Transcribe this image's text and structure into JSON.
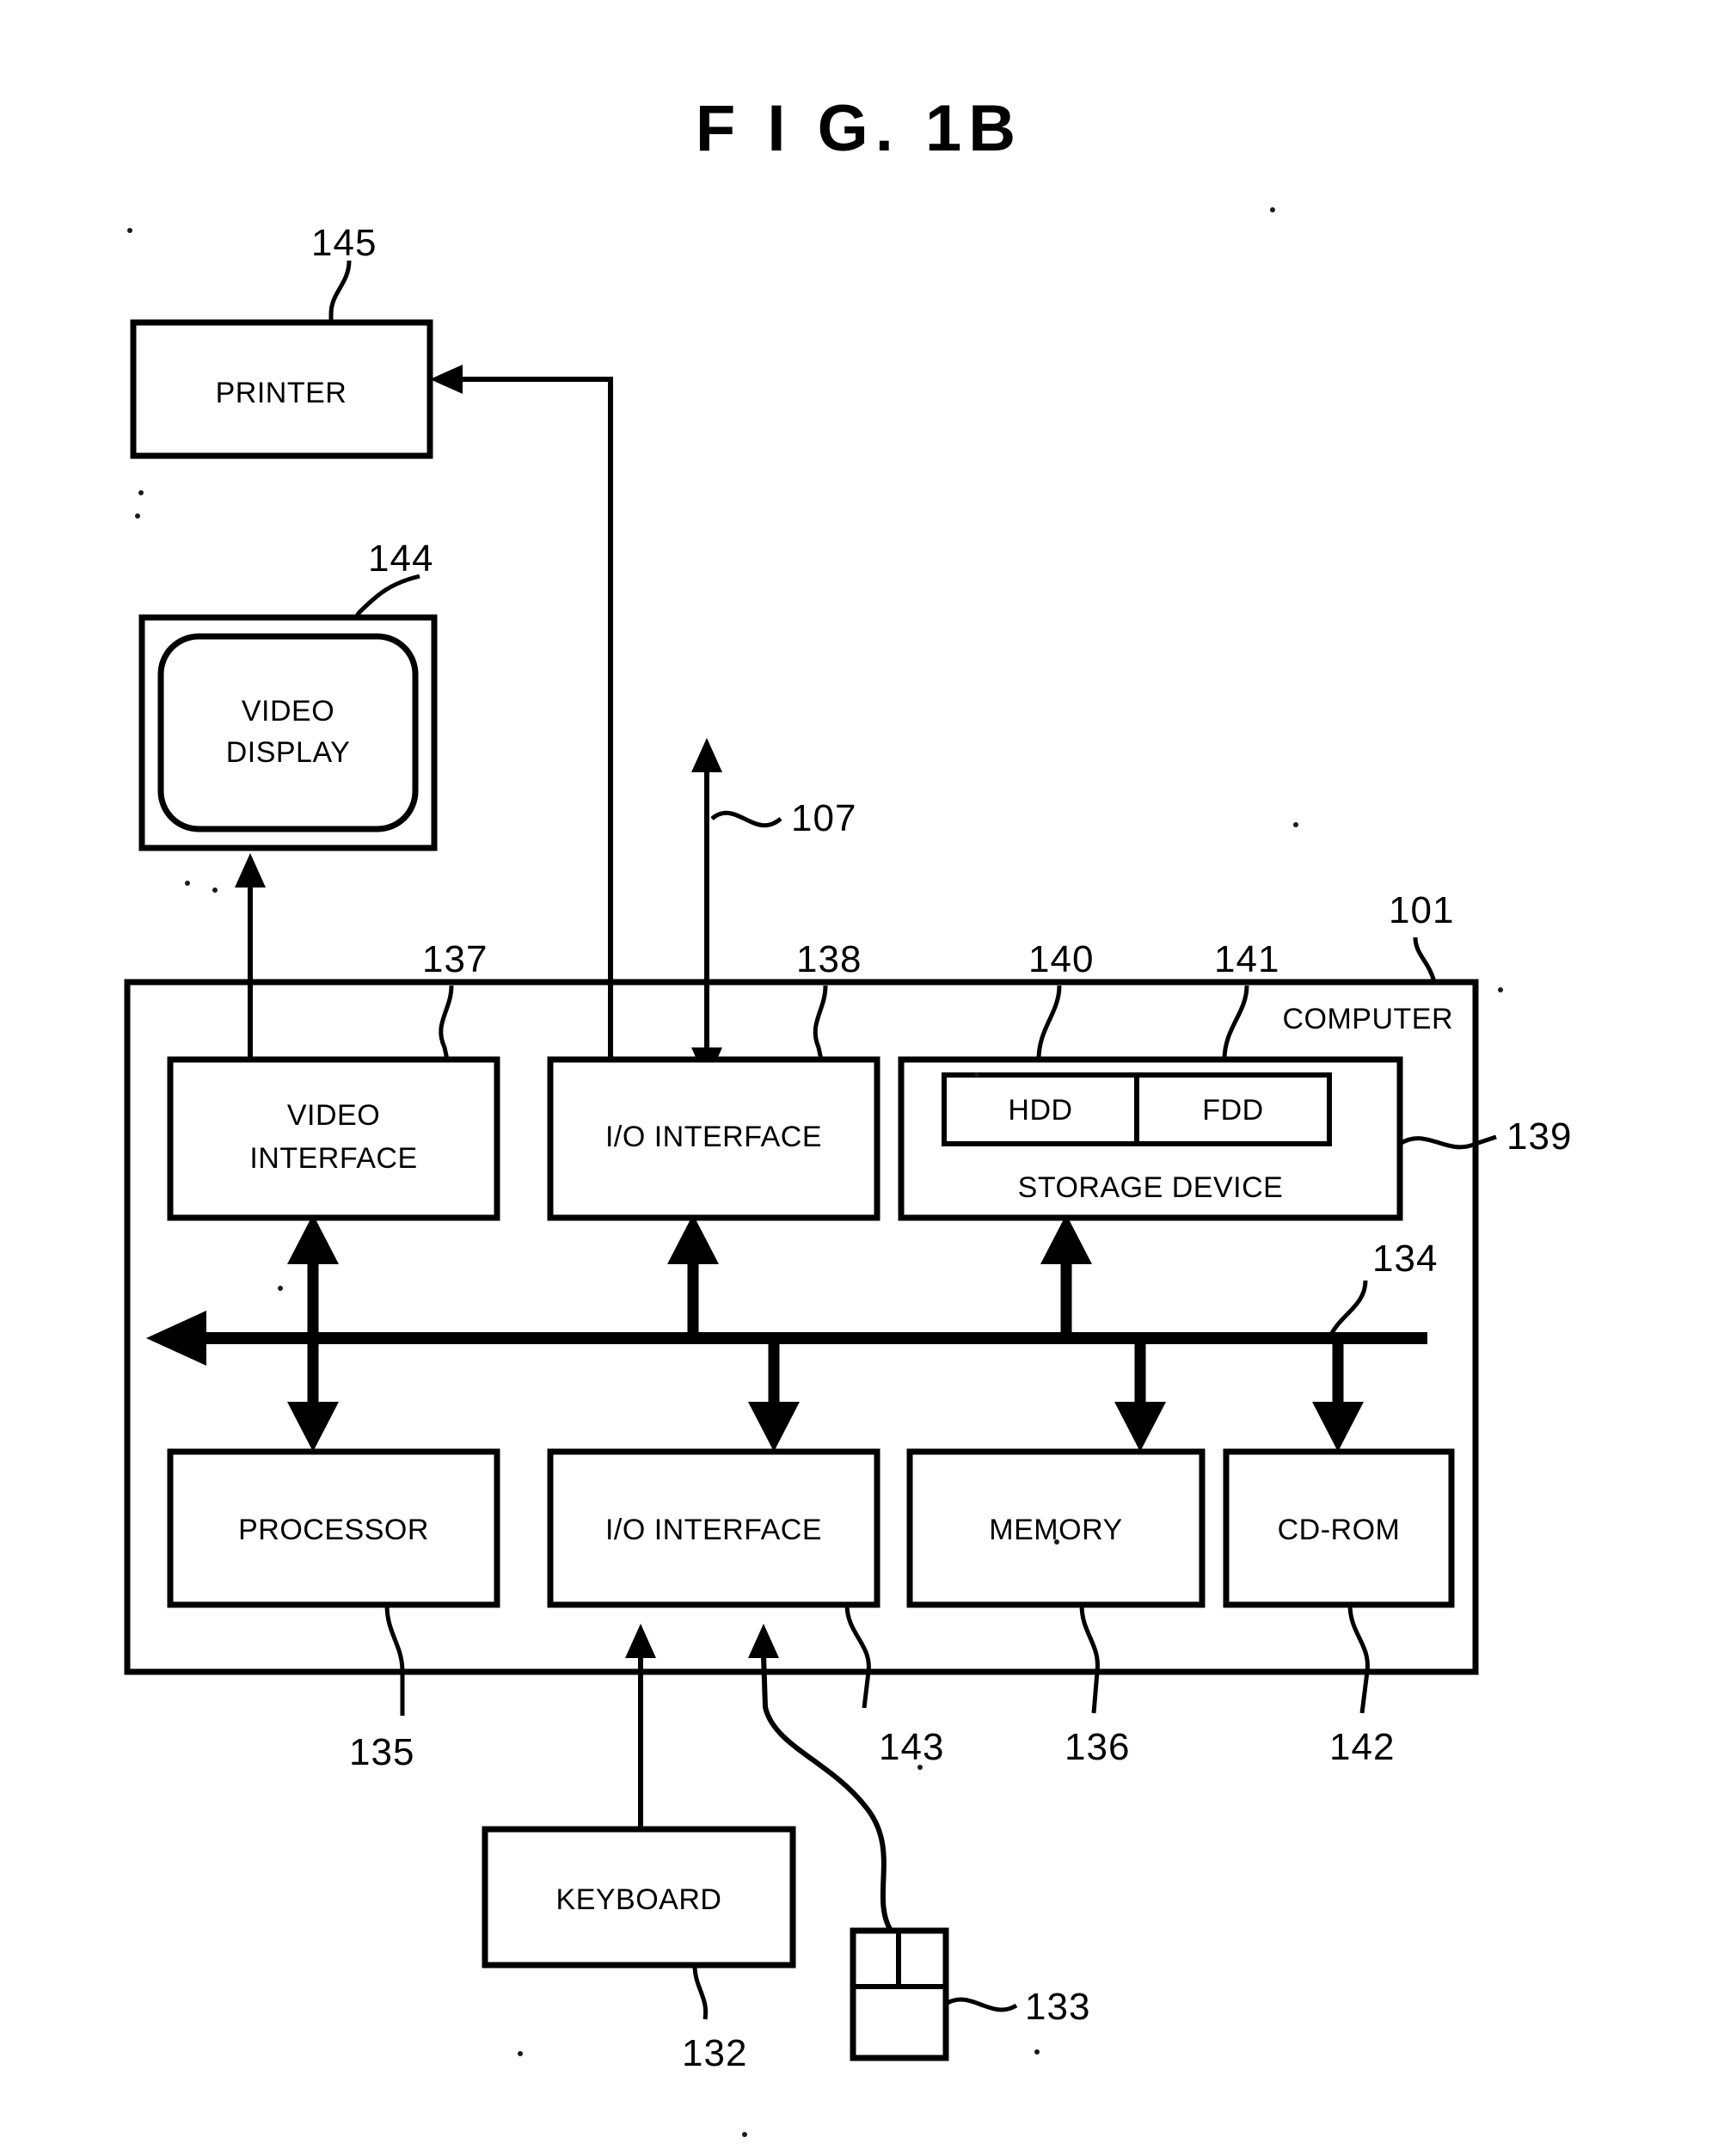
{
  "figure": {
    "title": "F I G.  1B"
  },
  "blocks": {
    "printer": {
      "label": "PRINTER",
      "ref": "145"
    },
    "video_display": {
      "label_line1": "VIDEO",
      "label_line2": "DISPLAY",
      "ref": "144"
    },
    "computer": {
      "label": "COMPUTER",
      "ref": "101"
    },
    "video_interface": {
      "label_line1": "VIDEO",
      "label_line2": "INTERFACE",
      "ref": "137"
    },
    "io_interface_top": {
      "label": "I/O INTERFACE",
      "ref": "138"
    },
    "storage_device": {
      "label": "STORAGE DEVICE",
      "ref": "139"
    },
    "hdd": {
      "label": "HDD",
      "ref": "140"
    },
    "fdd": {
      "label": "FDD",
      "ref": "141"
    },
    "processor": {
      "label": "PROCESSOR",
      "ref": "135"
    },
    "io_interface_bottom": {
      "label": "I/O INTERFACE",
      "ref": "143"
    },
    "memory": {
      "label": "MEMORY",
      "ref": "136"
    },
    "cdrom": {
      "label": "CD-ROM",
      "ref": "142"
    },
    "keyboard": {
      "label": "KEYBOARD",
      "ref": "132"
    },
    "mouse": {
      "label": "",
      "ref": "133"
    },
    "bus": {
      "label": "",
      "ref": "134"
    },
    "network_link": {
      "label": "",
      "ref": "107"
    }
  },
  "reference_numerals": [
    {
      "id": "ref-145",
      "value": "145",
      "target": "printer"
    },
    {
      "id": "ref-144",
      "value": "144",
      "target": "video-display"
    },
    {
      "id": "ref-107",
      "value": "107",
      "target": "network-link"
    },
    {
      "id": "ref-101",
      "value": "101",
      "target": "computer"
    },
    {
      "id": "ref-137",
      "value": "137",
      "target": "video-interface"
    },
    {
      "id": "ref-138",
      "value": "138",
      "target": "io-interface-top"
    },
    {
      "id": "ref-140",
      "value": "140",
      "target": "hdd"
    },
    {
      "id": "ref-141",
      "value": "141",
      "target": "fdd"
    },
    {
      "id": "ref-139",
      "value": "139",
      "target": "storage-device"
    },
    {
      "id": "ref-134",
      "value": "134",
      "target": "bus"
    },
    {
      "id": "ref-135",
      "value": "135",
      "target": "processor"
    },
    {
      "id": "ref-143",
      "value": "143",
      "target": "io-interface-bottom"
    },
    {
      "id": "ref-136",
      "value": "136",
      "target": "memory"
    },
    {
      "id": "ref-142",
      "value": "142",
      "target": "cdrom"
    },
    {
      "id": "ref-132",
      "value": "132",
      "target": "keyboard"
    },
    {
      "id": "ref-133",
      "value": "133",
      "target": "mouse"
    }
  ],
  "colors": {
    "ink": "#000000",
    "paper": "#ffffff"
  }
}
